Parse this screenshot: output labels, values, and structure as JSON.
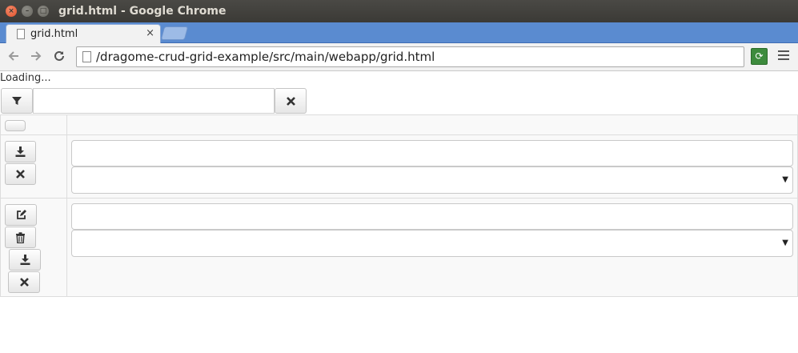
{
  "window": {
    "title": "grid.html - Google Chrome"
  },
  "tab": {
    "label": "grid.html",
    "close": "×"
  },
  "address_bar": {
    "url": "/dragome-crud-grid-example/src/main/webapp/grid.html"
  },
  "page": {
    "status_text": "Loading...",
    "filter": {
      "value": "",
      "filter_icon": "filter-icon",
      "clear_icon": "times-icon"
    },
    "grid": {
      "header": {
        "toggle_icon": "blank-toggle"
      },
      "new_row": {
        "text_value": "",
        "select_value": "",
        "actions": [
          "download-icon",
          "times-icon"
        ]
      },
      "rows": [
        {
          "text_value": "",
          "select_value": "",
          "actions": [
            "edit-icon",
            "trash-icon",
            "download-icon",
            "times-icon"
          ]
        }
      ]
    }
  }
}
